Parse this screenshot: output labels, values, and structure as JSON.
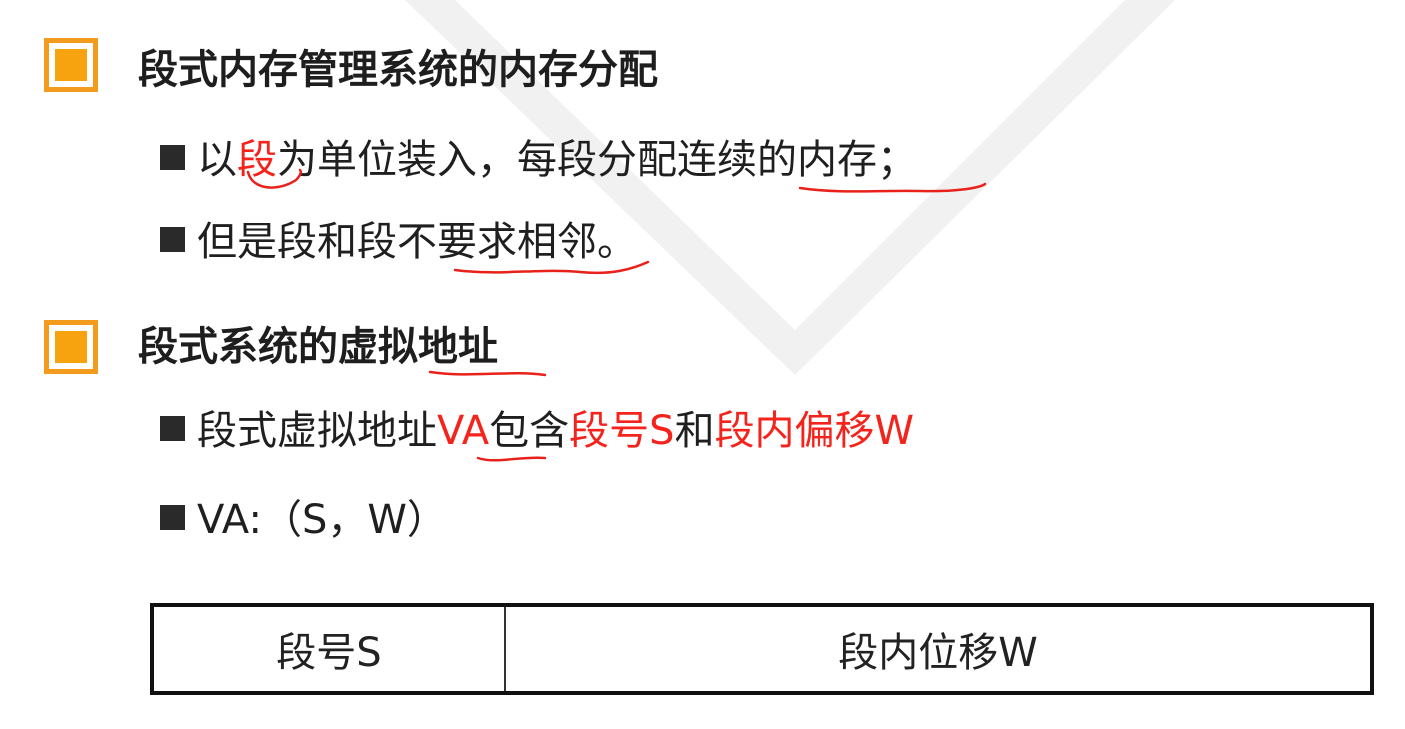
{
  "sections": [
    {
      "title": "段式内存管理系统的内存分配",
      "bullets": [
        {
          "parts": [
            "以",
            "段",
            "为单位装入，每段分配连续的内存；"
          ]
        },
        {
          "parts": [
            "但是段和段不要求相邻。"
          ]
        }
      ]
    },
    {
      "title": "段式系统的虚拟地址",
      "bullets": [
        {
          "parts": [
            "段式虚拟地址",
            "VA",
            "包含",
            "段号S",
            "和",
            "段内偏移W"
          ]
        },
        {
          "parts": [
            "VA:（S，W）"
          ]
        }
      ]
    }
  ],
  "table": {
    "cells": [
      "段号S",
      "段内位移W"
    ]
  },
  "colors": {
    "accent_orange": "#f29b1d",
    "highlight_red": "#f4231c",
    "annotation_red": "#e8211a",
    "watermark": "#f0f0f0"
  }
}
